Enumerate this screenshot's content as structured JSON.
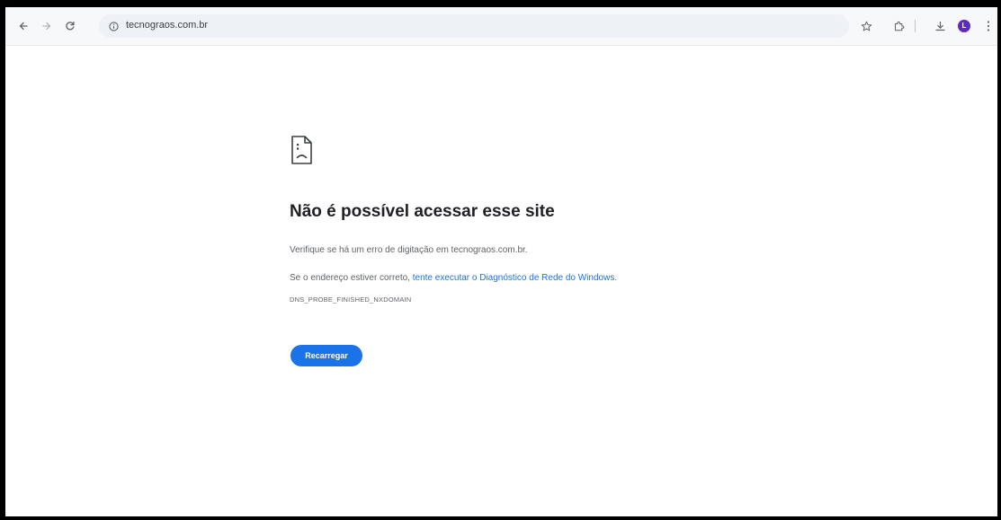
{
  "browser": {
    "url": "tecnograos.com.br",
    "avatar_letter": "L",
    "avatar_color": "#5b2bc0",
    "icons": {
      "back": "arrow-left-icon",
      "forward": "arrow-right-icon",
      "reload": "reload-icon",
      "site_info": "info-icon",
      "bookmark": "star-icon",
      "extensions": "puzzle-icon",
      "downloads": "download-icon",
      "menu": "more-vert-icon"
    }
  },
  "error_page": {
    "icon": "sad-page-icon",
    "title": "Não é possível acessar esse site",
    "line1": "Verifique se há um erro de digitação em tecnograos.com.br.",
    "line2_prefix": "Se o endereço estiver correto, ",
    "line2_link": "tente executar o Diagnóstico de Rede do Windows",
    "line2_suffix": ".",
    "error_code": "DNS_PROBE_FINISHED_NXDOMAIN",
    "reload_label": "Recarregar",
    "accent_color": "#1a73e8"
  }
}
